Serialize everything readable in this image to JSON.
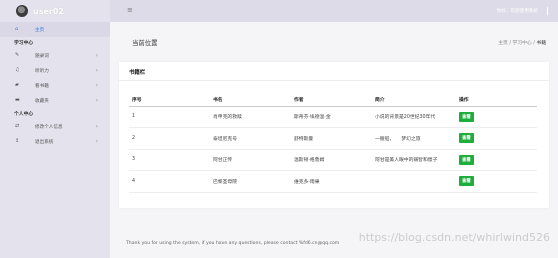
{
  "sidebar": {
    "username": "user02",
    "items": [
      {
        "label": "主页",
        "icon": "home-icon",
        "glyph": "⌂"
      },
      {
        "section": "学习中心"
      },
      {
        "label": "随录词",
        "icon": "edit-icon",
        "glyph": "✎"
      },
      {
        "label": "听听力",
        "icon": "headphones-icon",
        "glyph": "♫"
      },
      {
        "label": "看书籍",
        "icon": "book-icon",
        "glyph": "▰"
      },
      {
        "label": "收藏夹",
        "icon": "folder-icon",
        "glyph": "▬"
      },
      {
        "section": "个人中心"
      },
      {
        "label": "修改个人信息",
        "icon": "transfer-icon",
        "glyph": "⇄"
      },
      {
        "label": "退出系统",
        "icon": "logout-icon",
        "glyph": "↥"
      }
    ]
  },
  "topbar": {
    "menu_glyph": "≡",
    "welcome": "你好，欢迎使用系统"
  },
  "page": {
    "title": "当前位置",
    "breadcrumb": [
      "主页",
      "学习中心",
      "书籍"
    ],
    "breadcrumb_sep": "/"
  },
  "panel": {
    "title": "书籍栏",
    "headers": [
      "序号",
      "书名",
      "作者",
      "简介",
      "操作"
    ],
    "rows": [
      {
        "num": "1",
        "name": "肖申克的救赎",
        "author": "斯蒂芬·埃德温·金",
        "intro": "小说的背景是20世纪30年代",
        "action": "查看"
      },
      {
        "num": "2",
        "name": "泰坦尼克号",
        "author": "舒特斯曼",
        "intro": "一艘船，　　梦幻之旅",
        "action": "查看"
      },
      {
        "num": "3",
        "name": "阿甘正传",
        "author": "温斯顿·格鲁姆",
        "intro": "阿甘是美人眼中的弱智和傻子",
        "action": "查看"
      },
      {
        "num": "4",
        "name": "巴黎圣母院",
        "author": "维克多·雨果",
        "intro": "",
        "action": "查看"
      }
    ]
  },
  "footer": {
    "text": "Thank you for using the system, if you have any questions, please contact %fd6.cn@qq.com"
  },
  "watermark": "https://blog.csdn.net/whirlwind526",
  "colors": {
    "sidebar_bg": "#e4e2ec",
    "topbar_bg": "#dddbe7",
    "accent": "#2f7be0",
    "button": "#1fae3c"
  }
}
